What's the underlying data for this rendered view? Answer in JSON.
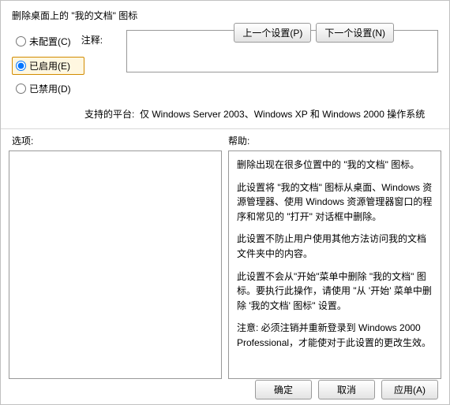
{
  "title": "删除桌面上的 \"我的文档\" 图标",
  "nav": {
    "prev": "上一个设置(P)",
    "next": "下一个设置(N)"
  },
  "radios": {
    "unconfigured": "未配置(C)",
    "enabled": "已启用(E)",
    "disabled": "已禁用(D)",
    "selected": "enabled"
  },
  "labels": {
    "comment": "注释:",
    "platform": "支持的平台:",
    "options": "选项:",
    "help": "帮助:"
  },
  "platform_value": "仅 Windows Server 2003、Windows XP 和 Windows 2000 操作系统",
  "help_paragraphs": [
    "删除出现在很多位置中的 \"我的文档\" 图标。",
    "此设置将 \"我的文档\" 图标从桌面、Windows 资源管理器、使用 Windows 资源管理器窗口的程序和常见的 \"打开\" 对话框中删除。",
    "此设置不防止用户使用其他方法访问我的文档文件夹中的内容。",
    "此设置不会从\"开始\"菜单中删除 \"我的文档\" 图标。要执行此操作，请使用 \"从 '开始' 菜单中删除 '我的文档' 图标\" 设置。",
    "注意: 必须注销并重新登录到 Windows 2000 Professional，才能使对于此设置的更改生效。"
  ],
  "footer": {
    "ok": "确定",
    "cancel": "取消",
    "apply": "应用(A)"
  }
}
